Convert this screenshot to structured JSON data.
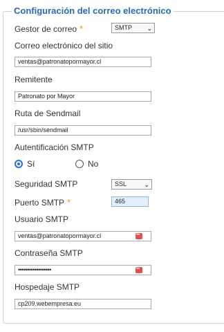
{
  "fieldset": {
    "legend": "Configuración del correo electrónico"
  },
  "fields": {
    "mailer": {
      "label": "Gestor de correo",
      "required_mark": "*",
      "value": "SMTP"
    },
    "site_email": {
      "label": "Correo electrónico del sitio",
      "value": "ventas@patronatopormayor.cl"
    },
    "from_name": {
      "label": "Remitente",
      "value": "Patronato por Mayor"
    },
    "sendmail_path": {
      "label": "Ruta de Sendmail",
      "value": "/usr/sbin/sendmail"
    },
    "smtp_auth": {
      "label": "Autentificación SMTP",
      "yes_label": "Sí",
      "no_label": "No",
      "selected": "Sí"
    },
    "smtp_security": {
      "label": "Seguridad SMTP",
      "value": "SSL"
    },
    "smtp_port": {
      "label": "Puerto SMTP",
      "required_mark": "*",
      "value": "465"
    },
    "smtp_user": {
      "label": "Usuario SMTP",
      "value": "ventas@patronatopormayor.cl"
    },
    "smtp_password": {
      "label": "Contraseña SMTP",
      "value": "••••••••••••••••••"
    },
    "smtp_host": {
      "label": "Hospedaje SMTP",
      "value": "cp209.webempresa.eu"
    }
  },
  "icons": {
    "select_caret": "chevron-down-icon",
    "password_manager": "password-key-icon"
  },
  "colors": {
    "legend": "#2a69b8",
    "required": "#e5a000",
    "radio_accent": "#1a73e8",
    "key_badge": "#e05050"
  }
}
